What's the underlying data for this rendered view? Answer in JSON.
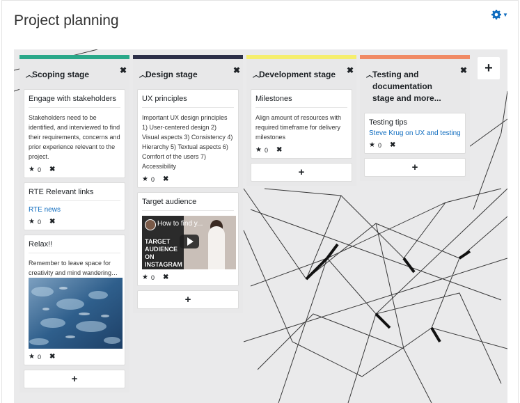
{
  "page": {
    "title": "Project planning"
  },
  "settings": {
    "icon": "gear-icon",
    "color": "#0f6cbf"
  },
  "columns": [
    {
      "title": "Scoping stage",
      "color": "#2aa889",
      "cards": [
        {
          "title": "Engage with stakeholders",
          "body": "Stakeholders need to be identified, and interviewed to find their requirements, concerns and prior experience relevant to the project.",
          "rating": "0"
        },
        {
          "title": "RTE Relevant links",
          "link": "RTE news",
          "rating": "0"
        },
        {
          "title": "Relax!!",
          "body": "Remember to leave space for creativity and mind wandering…",
          "image": "water-photo",
          "rating": "0"
        }
      ]
    },
    {
      "title": "Design stage",
      "color": "#2c2f48",
      "cards": [
        {
          "title": "UX principles",
          "body": "Important UX design principles 1) User-centered design 2) Visual aspects 3) Consistency 4) Hierarchy 5) Textual aspects 6) Comfort of the users 7) Accessibility",
          "rating": "0"
        },
        {
          "title": "Target audience",
          "video": {
            "title": "How to find y...",
            "thumb_text": "TARGET AUDIENCE ON INSTAGRAM"
          },
          "rating": "0"
        }
      ]
    },
    {
      "title": "Development stage",
      "color": "#f5ee6e",
      "cards": [
        {
          "title": "Milestones",
          "body": "Align amount of resources with required timeframe for delivery milestones",
          "rating": "0"
        }
      ]
    },
    {
      "title": "Testing and documentation stage and more...",
      "color": "#f08a64",
      "cards": [
        {
          "title": "Testing tips",
          "link": "Steve Krug on UX and testing",
          "rating": "0"
        }
      ]
    }
  ],
  "add_label": "+",
  "close_label": "✖",
  "collapse_label": "^"
}
